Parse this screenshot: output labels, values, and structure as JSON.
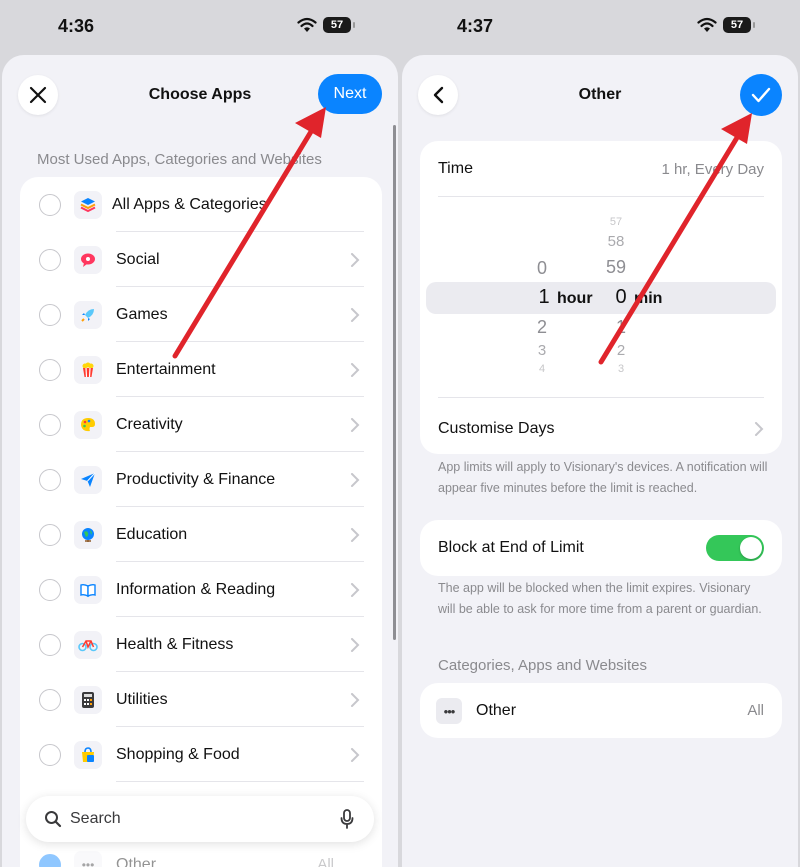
{
  "status_left": {
    "time": "4:36",
    "battery": "57"
  },
  "status_right": {
    "time": "4:37",
    "battery": "57"
  },
  "left": {
    "title": "Choose Apps",
    "next_label": "Next",
    "section_header": "Most Used Apps, Categories and Websites",
    "items": [
      {
        "label": "All Apps & Categories",
        "icon": "stack-icon"
      },
      {
        "label": "Social",
        "icon": "speech-bubble-icon"
      },
      {
        "label": "Games",
        "icon": "rocket-icon"
      },
      {
        "label": "Entertainment",
        "icon": "popcorn-icon"
      },
      {
        "label": "Creativity",
        "icon": "palette-icon"
      },
      {
        "label": "Productivity & Finance",
        "icon": "paper-plane-icon"
      },
      {
        "label": "Education",
        "icon": "globe-icon"
      },
      {
        "label": "Information & Reading",
        "icon": "book-icon"
      },
      {
        "label": "Health & Fitness",
        "icon": "bicycle-icon"
      },
      {
        "label": "Utilities",
        "icon": "calculator-icon"
      },
      {
        "label": "Shopping & Food",
        "icon": "shopping-bag-icon"
      }
    ],
    "search_placeholder": "Search",
    "partial_row_label": "Other",
    "partial_row_value": "All"
  },
  "right": {
    "title": "Other",
    "time_label": "Time",
    "time_value": "1 hr, Every Day",
    "picker": {
      "hours_above": [
        "0"
      ],
      "hours_below": [
        "2",
        "3",
        "4"
      ],
      "hour_selected": "1",
      "hour_unit": "hour",
      "mins_above": [
        "57",
        "58",
        "59"
      ],
      "mins_below": [
        "1",
        "2",
        "3"
      ],
      "min_selected": "0",
      "min_unit": "min"
    },
    "customise_label": "Customise Days",
    "limit_note": "App limits will apply to Visionary's devices. A notification will appear five minutes before the limit is reached.",
    "block_label": "Block at End of Limit",
    "block_enabled": true,
    "block_note": "The app will be blocked when the limit expires. Visionary will be able to ask for more time from a parent or guardian.",
    "categories_header": "Categories, Apps and Websites",
    "other_label": "Other",
    "other_value": "All"
  },
  "colors": {
    "accent": "#0a84ff",
    "toggle_on": "#34c759",
    "annotation_arrow": "#e0242b"
  }
}
